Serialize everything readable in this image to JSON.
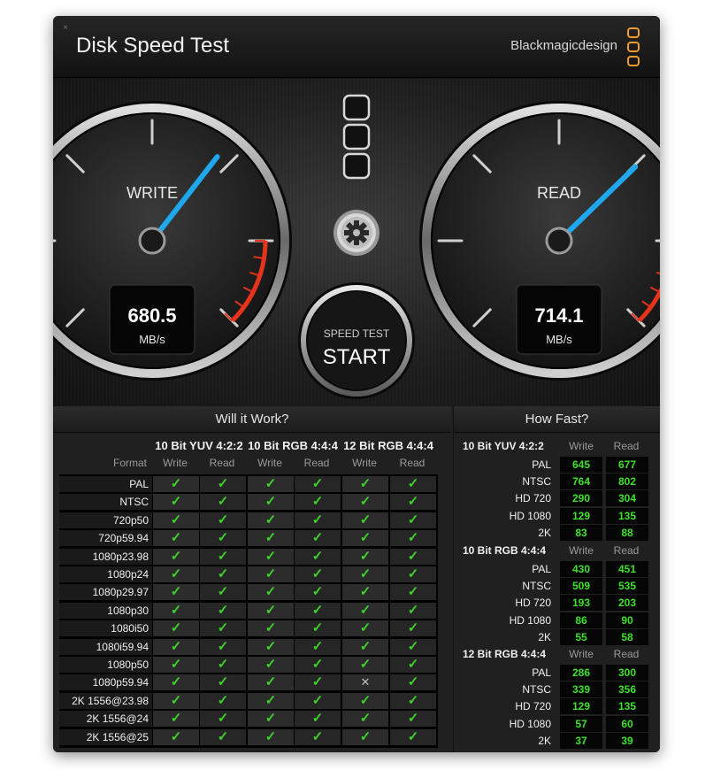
{
  "window": {
    "close_symbol": "×"
  },
  "title": "Disk Speed Test",
  "brand": "Blackmagicdesign",
  "write_gauge": {
    "label": "WRITE",
    "value": "680.5",
    "unit": "MB/s",
    "needle_fraction": 0.64
  },
  "read_gauge": {
    "label": "READ",
    "value": "714.1",
    "unit": "MB/s",
    "needle_fraction": 0.67
  },
  "center": {
    "settings_icon": "gear-icon",
    "start_top": "SPEED TEST",
    "start_main": "START"
  },
  "will_it_work": {
    "title": "Will it Work?",
    "format_header": "Format",
    "groups": [
      "10 Bit YUV 4:2:2",
      "10 Bit RGB 4:4:4",
      "12 Bit RGB 4:4:4"
    ],
    "sub_headers": [
      "Write",
      "Read",
      "Write",
      "Read",
      "Write",
      "Read"
    ],
    "check_glyph": "✓",
    "cross_glyph": "✕",
    "rows": [
      {
        "name": "PAL",
        "cells": [
          "check",
          "check",
          "check",
          "check",
          "check",
          "check"
        ]
      },
      {
        "name": "NTSC",
        "cells": [
          "check",
          "check",
          "check",
          "check",
          "check",
          "check"
        ]
      },
      {
        "name": "720p50",
        "cells": [
          "check",
          "check",
          "check",
          "check",
          "check",
          "check"
        ]
      },
      {
        "name": "720p59.94",
        "cells": [
          "check",
          "check",
          "check",
          "check",
          "check",
          "check"
        ]
      },
      {
        "name": "1080p23.98",
        "cells": [
          "check",
          "check",
          "check",
          "check",
          "check",
          "check"
        ]
      },
      {
        "name": "1080p24",
        "cells": [
          "check",
          "check",
          "check",
          "check",
          "check",
          "check"
        ]
      },
      {
        "name": "1080p29.97",
        "cells": [
          "check",
          "check",
          "check",
          "check",
          "check",
          "check"
        ]
      },
      {
        "name": "1080p30",
        "cells": [
          "check",
          "check",
          "check",
          "check",
          "check",
          "check"
        ]
      },
      {
        "name": "1080i50",
        "cells": [
          "check",
          "check",
          "check",
          "check",
          "check",
          "check"
        ]
      },
      {
        "name": "1080i59.94",
        "cells": [
          "check",
          "check",
          "check",
          "check",
          "check",
          "check"
        ]
      },
      {
        "name": "1080p50",
        "cells": [
          "check",
          "check",
          "check",
          "check",
          "check",
          "check"
        ]
      },
      {
        "name": "1080p59.94",
        "cells": [
          "check",
          "check",
          "check",
          "check",
          "cross",
          "check"
        ]
      },
      {
        "name": "2K 1556@23.98",
        "cells": [
          "check",
          "check",
          "check",
          "check",
          "check",
          "check"
        ]
      },
      {
        "name": "2K 1556@24",
        "cells": [
          "check",
          "check",
          "check",
          "check",
          "check",
          "check"
        ]
      },
      {
        "name": "2K 1556@25",
        "cells": [
          "check",
          "check",
          "check",
          "check",
          "check",
          "check"
        ]
      }
    ]
  },
  "how_fast": {
    "title": "How Fast?",
    "write_header": "Write",
    "read_header": "Read",
    "groups": [
      {
        "name": "10 Bit YUV 4:2:2",
        "rows": [
          {
            "label": "PAL",
            "write": "645",
            "read": "677"
          },
          {
            "label": "NTSC",
            "write": "764",
            "read": "802"
          },
          {
            "label": "HD 720",
            "write": "290",
            "read": "304"
          },
          {
            "label": "HD 1080",
            "write": "129",
            "read": "135"
          },
          {
            "label": "2K",
            "write": "83",
            "read": "88"
          }
        ]
      },
      {
        "name": "10 Bit RGB 4:4:4",
        "rows": [
          {
            "label": "PAL",
            "write": "430",
            "read": "451"
          },
          {
            "label": "NTSC",
            "write": "509",
            "read": "535"
          },
          {
            "label": "HD 720",
            "write": "193",
            "read": "203"
          },
          {
            "label": "HD 1080",
            "write": "86",
            "read": "90"
          },
          {
            "label": "2K",
            "write": "55",
            "read": "58"
          }
        ]
      },
      {
        "name": "12 Bit RGB 4:4:4",
        "rows": [
          {
            "label": "PAL",
            "write": "286",
            "read": "300"
          },
          {
            "label": "NTSC",
            "write": "339",
            "read": "356"
          },
          {
            "label": "HD 720",
            "write": "129",
            "read": "135"
          },
          {
            "label": "HD 1080",
            "write": "57",
            "read": "60"
          },
          {
            "label": "2K",
            "write": "37",
            "read": "39"
          }
        ]
      }
    ]
  },
  "colors": {
    "needle": "#1fa8ef",
    "redzone": "#e5341b",
    "value_green": "#3ee02a",
    "logo_orange": "#f09a2e"
  }
}
